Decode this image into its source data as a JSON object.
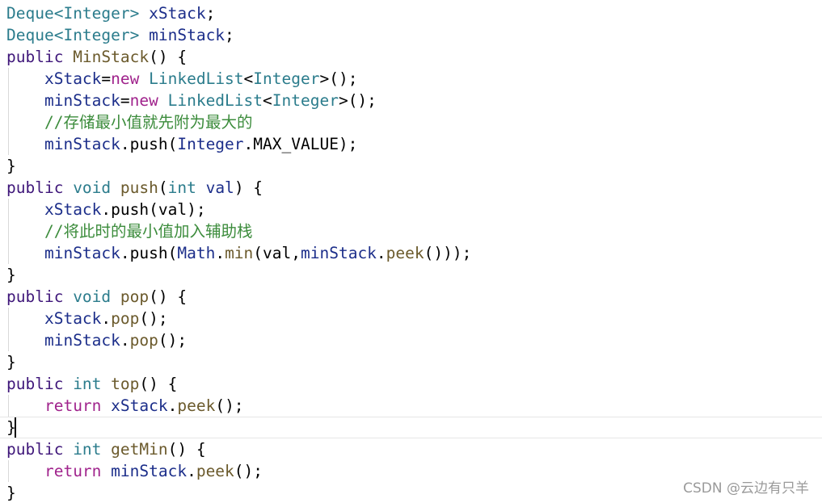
{
  "editor": {
    "lines": [
      [
        {
          "t": "Deque<",
          "c": "type"
        },
        {
          "t": "Integer",
          "c": "type"
        },
        {
          "t": "> ",
          "c": "type"
        },
        {
          "t": "xStack",
          "c": "field"
        },
        {
          "t": ";",
          "c": "plain"
        }
      ],
      [
        {
          "t": "Deque<",
          "c": "type"
        },
        {
          "t": "Integer",
          "c": "type"
        },
        {
          "t": "> ",
          "c": "type"
        },
        {
          "t": "minStack",
          "c": "field"
        },
        {
          "t": ";",
          "c": "plain"
        }
      ],
      [
        {
          "t": "public ",
          "c": "keyword"
        },
        {
          "t": "MinStack",
          "c": "func"
        },
        {
          "t": "() {",
          "c": "plain"
        }
      ],
      [
        {
          "t": "    ",
          "c": "plain"
        },
        {
          "t": "xStack",
          "c": "field"
        },
        {
          "t": "=",
          "c": "plain"
        },
        {
          "t": "new ",
          "c": "keyword2"
        },
        {
          "t": "LinkedList",
          "c": "type"
        },
        {
          "t": "<",
          "c": "plain"
        },
        {
          "t": "Integer",
          "c": "type"
        },
        {
          "t": ">();",
          "c": "plain"
        }
      ],
      [
        {
          "t": "    ",
          "c": "plain"
        },
        {
          "t": "minStack",
          "c": "field"
        },
        {
          "t": "=",
          "c": "plain"
        },
        {
          "t": "new ",
          "c": "keyword2"
        },
        {
          "t": "LinkedList",
          "c": "type"
        },
        {
          "t": "<",
          "c": "plain"
        },
        {
          "t": "Integer",
          "c": "type"
        },
        {
          "t": ">();",
          "c": "plain"
        }
      ],
      [
        {
          "t": "    ",
          "c": "plain"
        },
        {
          "t": "//存储最小值就先附为最大的",
          "c": "comment"
        }
      ],
      [
        {
          "t": "    ",
          "c": "plain"
        },
        {
          "t": "minStack",
          "c": "field"
        },
        {
          "t": ".push(",
          "c": "plain"
        },
        {
          "t": "Integer",
          "c": "field"
        },
        {
          "t": ".MAX_VALUE);",
          "c": "plain"
        }
      ],
      [
        {
          "t": "}",
          "c": "plain"
        }
      ],
      [
        {
          "t": "public ",
          "c": "keyword"
        },
        {
          "t": "void ",
          "c": "type"
        },
        {
          "t": "push",
          "c": "func"
        },
        {
          "t": "(",
          "c": "plain"
        },
        {
          "t": "int ",
          "c": "type"
        },
        {
          "t": "val",
          "c": "param"
        },
        {
          "t": ") {",
          "c": "plain"
        }
      ],
      [
        {
          "t": "    ",
          "c": "plain"
        },
        {
          "t": "xStack",
          "c": "field"
        },
        {
          "t": ".push(val);",
          "c": "plain"
        }
      ],
      [
        {
          "t": "    ",
          "c": "plain"
        },
        {
          "t": "//将此时的最小值加入辅助栈",
          "c": "comment"
        }
      ],
      [
        {
          "t": "    ",
          "c": "plain"
        },
        {
          "t": "minStack",
          "c": "field"
        },
        {
          "t": ".push(",
          "c": "plain"
        },
        {
          "t": "Math",
          "c": "field"
        },
        {
          "t": ".",
          "c": "plain"
        },
        {
          "t": "min",
          "c": "func"
        },
        {
          "t": "(val,",
          "c": "plain"
        },
        {
          "t": "minStack",
          "c": "field"
        },
        {
          "t": ".",
          "c": "plain"
        },
        {
          "t": "peek",
          "c": "func"
        },
        {
          "t": "()));",
          "c": "plain"
        }
      ],
      [
        {
          "t": "}",
          "c": "plain"
        }
      ],
      [
        {
          "t": "public ",
          "c": "keyword"
        },
        {
          "t": "void ",
          "c": "type"
        },
        {
          "t": "pop",
          "c": "func"
        },
        {
          "t": "() {",
          "c": "plain"
        }
      ],
      [
        {
          "t": "    ",
          "c": "plain"
        },
        {
          "t": "xStack",
          "c": "field"
        },
        {
          "t": ".",
          "c": "plain"
        },
        {
          "t": "pop",
          "c": "func"
        },
        {
          "t": "();",
          "c": "plain"
        }
      ],
      [
        {
          "t": "    ",
          "c": "plain"
        },
        {
          "t": "minStack",
          "c": "field"
        },
        {
          "t": ".",
          "c": "plain"
        },
        {
          "t": "pop",
          "c": "func"
        },
        {
          "t": "();",
          "c": "plain"
        }
      ],
      [
        {
          "t": "}",
          "c": "plain"
        }
      ],
      [
        {
          "t": "public ",
          "c": "keyword"
        },
        {
          "t": "int ",
          "c": "type"
        },
        {
          "t": "top",
          "c": "func"
        },
        {
          "t": "() {",
          "c": "plain"
        }
      ],
      [
        {
          "t": "    ",
          "c": "plain"
        },
        {
          "t": "return ",
          "c": "keyword2"
        },
        {
          "t": "xStack",
          "c": "field"
        },
        {
          "t": ".",
          "c": "plain"
        },
        {
          "t": "peek",
          "c": "func"
        },
        {
          "t": "();",
          "c": "plain"
        }
      ],
      [
        {
          "t": "}",
          "c": "plain"
        }
      ],
      [
        {
          "t": "public ",
          "c": "keyword"
        },
        {
          "t": "int ",
          "c": "type"
        },
        {
          "t": "getMin",
          "c": "func"
        },
        {
          "t": "() {",
          "c": "plain"
        }
      ],
      [
        {
          "t": "    ",
          "c": "plain"
        },
        {
          "t": "return ",
          "c": "keyword2"
        },
        {
          "t": "minStack",
          "c": "field"
        },
        {
          "t": ".",
          "c": "plain"
        },
        {
          "t": "peek",
          "c": "func"
        },
        {
          "t": "();",
          "c": "plain"
        }
      ],
      [
        {
          "t": "}",
          "c": "plain"
        }
      ]
    ],
    "current_line": 19
  },
  "watermark": "CSDN @云边有只羊",
  "colors": {
    "plain": "#000000",
    "keyword": "#3f177a",
    "keyword2": "#a0238c",
    "type": "#2b7c8c",
    "field": "#1c2e8a",
    "func": "#6b5a2c",
    "param": "#1c2e8a",
    "comment": "#3c8c3c"
  }
}
